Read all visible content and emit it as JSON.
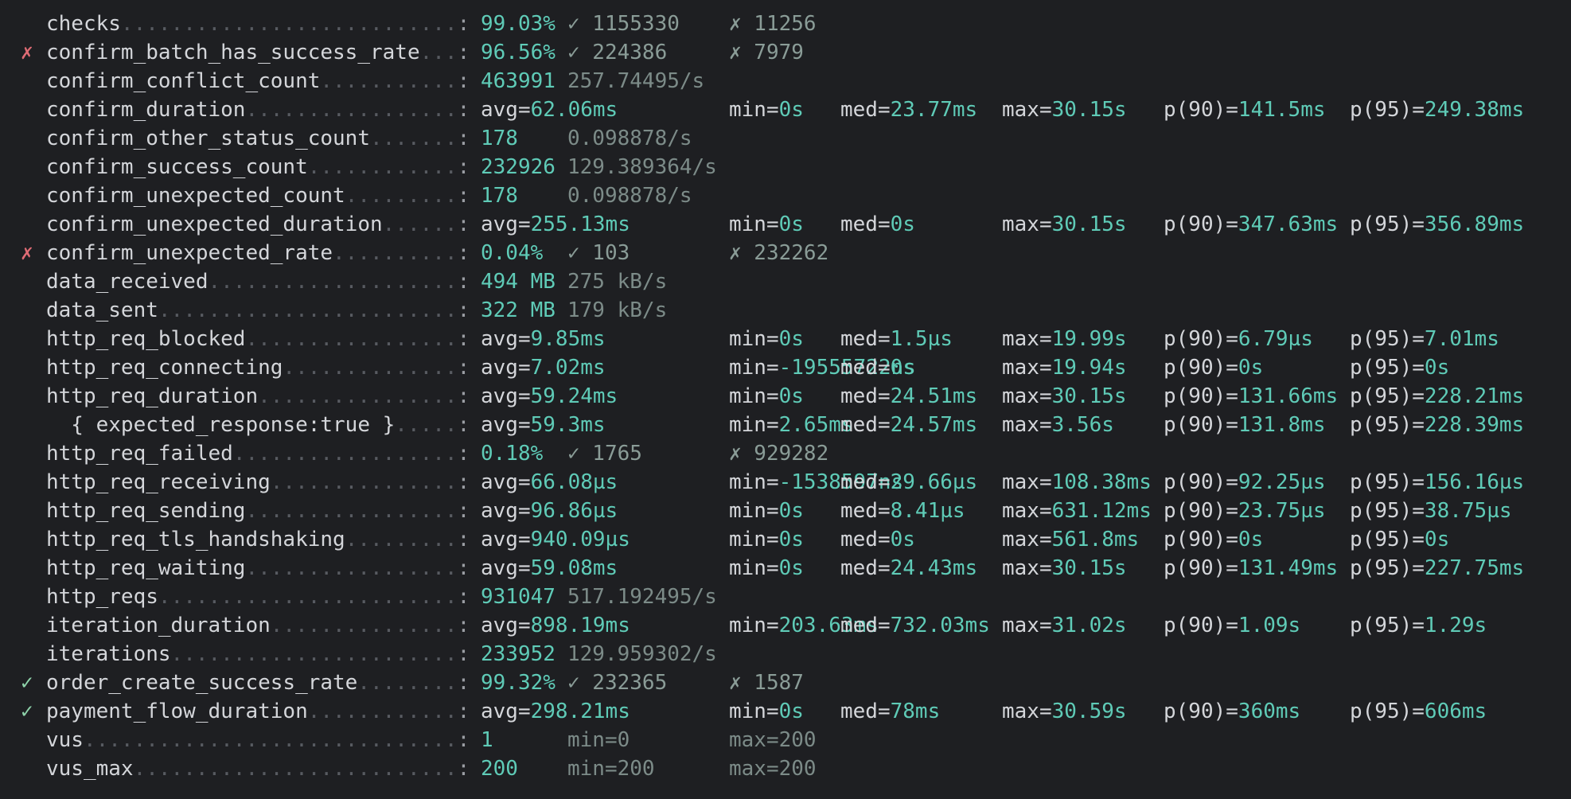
{
  "metrics": [
    {
      "mark": "",
      "name": "checks",
      "a": "99.03%",
      "ok": "✓ 1155330",
      "fail": "✗ 11256"
    },
    {
      "mark": "✗",
      "name": "confirm_batch_has_success_rate",
      "a": "96.56%",
      "ok": "✓ 224386",
      "fail": "✗ 7979"
    },
    {
      "mark": "",
      "name": "confirm_conflict_count",
      "a": "463991",
      "rate": "257.74495/s"
    },
    {
      "mark": "",
      "name": "confirm_duration",
      "avg": "62.06ms",
      "min": "0s",
      "med": "23.77ms",
      "max": "30.15s",
      "p90": "141.5ms",
      "p95": "249.38ms"
    },
    {
      "mark": "",
      "name": "confirm_other_status_count",
      "a": "178",
      "rate": "0.098878/s"
    },
    {
      "mark": "",
      "name": "confirm_success_count",
      "a": "232926",
      "rate": "129.389364/s"
    },
    {
      "mark": "",
      "name": "confirm_unexpected_count",
      "a": "178",
      "rate": "0.098878/s"
    },
    {
      "mark": "",
      "name": "confirm_unexpected_duration",
      "avg": "255.13ms",
      "min": "0s",
      "med": "0s",
      "max": "30.15s",
      "p90": "347.63ms",
      "p95": "356.89ms"
    },
    {
      "mark": "✗",
      "name": "confirm_unexpected_rate",
      "a": "0.04%",
      "ok": "✓ 103",
      "fail": "✗ 232262"
    },
    {
      "mark": "",
      "name": "data_received",
      "a": "494 MB",
      "rate": "275 kB/s"
    },
    {
      "mark": "",
      "name": "data_sent",
      "a": "322 MB",
      "rate": "179 kB/s"
    },
    {
      "mark": "",
      "name": "http_req_blocked",
      "avg": "9.85ms",
      "min": "0s",
      "med": "1.5µs",
      "max": "19.99s",
      "p90": "6.79µs",
      "p95": "7.01ms"
    },
    {
      "mark": "",
      "name": "http_req_connecting",
      "avg": "7.02ms",
      "min": "-19555722ns",
      "med": "0s",
      "max": "19.94s",
      "p90": "0s",
      "p95": "0s"
    },
    {
      "mark": "",
      "name": "http_req_duration",
      "avg": "59.24ms",
      "min": "0s",
      "med": "24.51ms",
      "max": "30.15s",
      "p90": "131.66ms",
      "p95": "228.21ms"
    },
    {
      "mark": "",
      "name": "  { expected_response:true }",
      "avg": "59.3ms",
      "min": "2.65ms",
      "med": "24.57ms",
      "max": "3.56s",
      "p90": "131.8ms",
      "p95": "228.39ms"
    },
    {
      "mark": "",
      "name": "http_req_failed",
      "a": "0.18%",
      "ok": "✓ 1765",
      "fail": "✗ 929282"
    },
    {
      "mark": "",
      "name": "http_req_receiving",
      "avg": "66.08µs",
      "min": "-1538597ns",
      "med": "29.66µs",
      "max": "108.38ms",
      "p90": "92.25µs",
      "p95": "156.16µs"
    },
    {
      "mark": "",
      "name": "http_req_sending",
      "avg": "96.86µs",
      "min": "0s",
      "med": "8.41µs",
      "max": "631.12ms",
      "p90": "23.75µs",
      "p95": "38.75µs"
    },
    {
      "mark": "",
      "name": "http_req_tls_handshaking",
      "avg": "940.09µs",
      "min": "0s",
      "med": "0s",
      "max": "561.8ms",
      "p90": "0s",
      "p95": "0s"
    },
    {
      "mark": "",
      "name": "http_req_waiting",
      "avg": "59.08ms",
      "min": "0s",
      "med": "24.43ms",
      "max": "30.15s",
      "p90": "131.49ms",
      "p95": "227.75ms"
    },
    {
      "mark": "",
      "name": "http_reqs",
      "a": "931047",
      "rate": "517.192495/s"
    },
    {
      "mark": "",
      "name": "iteration_duration",
      "avg": "898.19ms",
      "min": "203.63ms",
      "med": "732.03ms",
      "max": "31.02s",
      "p90": "1.09s",
      "p95": "1.29s"
    },
    {
      "mark": "",
      "name": "iterations",
      "a": "233952",
      "rate": "129.959302/s"
    },
    {
      "mark": "✓",
      "name": "order_create_success_rate",
      "a": "99.32%",
      "ok": "✓ 232365",
      "fail": "✗ 1587"
    },
    {
      "mark": "✓",
      "name": "payment_flow_duration",
      "avg": "298.21ms",
      "min": "0s",
      "med": "78ms",
      "max": "30.59s",
      "p90": "360ms",
      "p95": "606ms"
    },
    {
      "mark": "",
      "name": "vus",
      "a": "1",
      "vmin": "min=0",
      "vmax": "max=200"
    },
    {
      "mark": "",
      "name": "vus_max",
      "a": "200",
      "vmin": "min=200",
      "vmax": "max=200"
    }
  ]
}
